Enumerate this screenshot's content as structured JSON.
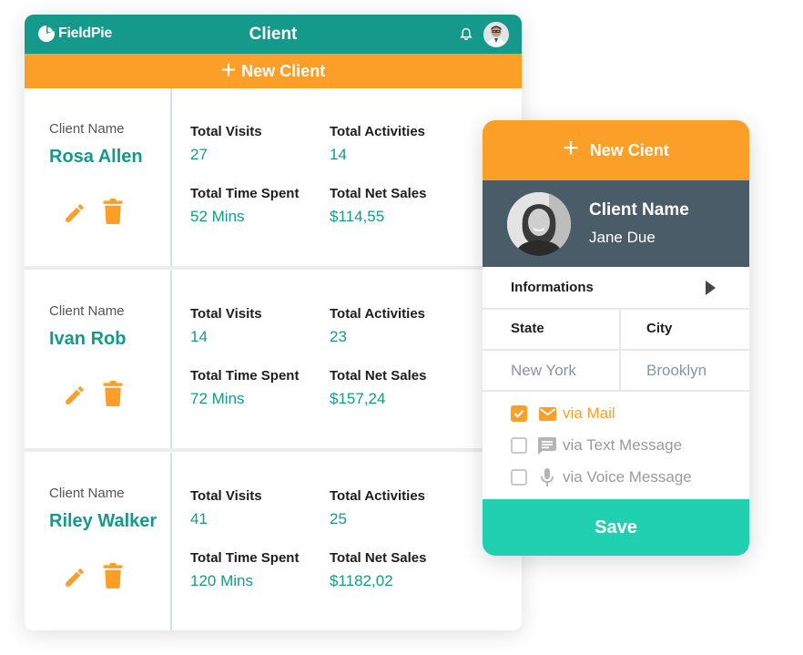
{
  "app": {
    "logo_text": "FieldPie",
    "title": "Client",
    "new_client_label": "New Client"
  },
  "icons": {
    "logo": "pie-chart-icon",
    "notifications": "bell-icon",
    "edit": "pencil-icon",
    "delete": "trash-icon",
    "add": "plus-icon",
    "expand": "play-arrow-icon",
    "mail": "mail-icon",
    "text": "chat-icon",
    "voice": "microphone-icon"
  },
  "colors": {
    "brand_teal": "#15998a",
    "accent_orange": "#fb9f28",
    "profile_slate": "#4a5c67",
    "save_green": "#21cfb1"
  },
  "clients": [
    {
      "name_label": "Client Name",
      "name": "Rosa Allen",
      "visits_label": "Total Visits",
      "visits": "27",
      "activities_label": "Total Activities",
      "activities": "14",
      "time_label": "Total Time Spent",
      "time": "52 Mins",
      "sales_label": "Total Net Sales",
      "sales": "$114,55"
    },
    {
      "name_label": "Client Name",
      "name": "Ivan Rob",
      "visits_label": "Total Visits",
      "visits": "14",
      "activities_label": "Total Activities",
      "activities": "23",
      "time_label": "Total Time Spent",
      "time": "72 Mins",
      "sales_label": "Total Net Sales",
      "sales": "$157,24"
    },
    {
      "name_label": "Client Name",
      "name": "Riley Walker",
      "visits_label": "Total Visits",
      "visits": "41",
      "activities_label": "Total Activities",
      "activities": "25",
      "time_label": "Total Time Spent",
      "time": "120 Mins",
      "sales_label": "Total Net Sales",
      "sales": "$1182,02"
    }
  ],
  "card": {
    "header": "New Cient",
    "profile_label": "Client Name",
    "profile_name": "Jane Due",
    "info_label": "Informations",
    "state_label": "State",
    "city_label": "City",
    "state_value": "New York",
    "city_value": "Brooklyn",
    "contact": [
      {
        "label": "via Mail",
        "checked": true
      },
      {
        "label": "via Text Message",
        "checked": false
      },
      {
        "label": "via Voice Message",
        "checked": false
      }
    ],
    "save_label": "Save"
  }
}
